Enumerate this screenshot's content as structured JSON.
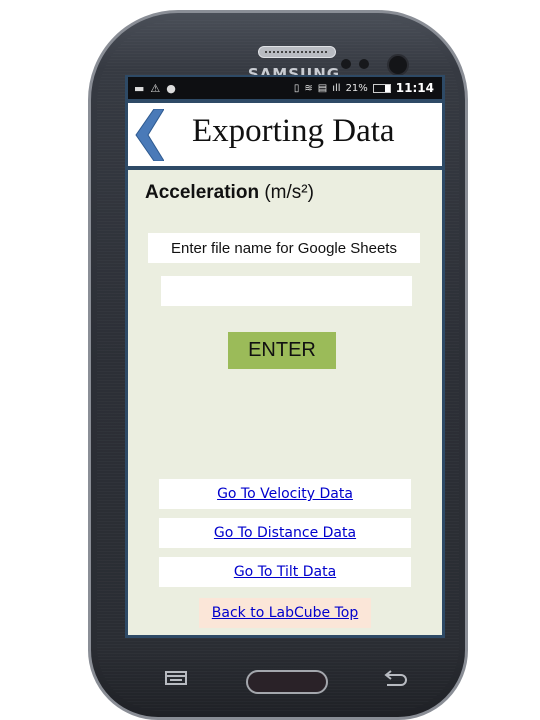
{
  "device": {
    "brand": "SAMSUNG"
  },
  "status_bar": {
    "left_icons": [
      "image-icon",
      "warning-icon",
      "drive-icon"
    ],
    "right_icons": [
      "vibrate-icon",
      "wifi-icon",
      "sim-icon",
      "signal-icon"
    ],
    "battery_percent": "21%",
    "time": "11:14"
  },
  "header": {
    "title": "Exporting Data",
    "back_icon": "chevron-left-icon",
    "accent_color": "#4a7ab8"
  },
  "main": {
    "section_label_bold": "Acceleration",
    "section_label_unit": "(m/s²)",
    "file_prompt": "Enter file name for Google Sheets",
    "file_input_value": "",
    "enter_button": "ENTER",
    "enter_button_color": "#9bbb59",
    "links": [
      {
        "label": "Go To Velocity Data"
      },
      {
        "label": "Go To Distance Data"
      },
      {
        "label": "Go To Tilt Data"
      }
    ],
    "back_link": "Back to LabCube Top",
    "background_color": "#ebeee0"
  },
  "hardware_keys": [
    "menu-key",
    "home-key",
    "back-key"
  ]
}
